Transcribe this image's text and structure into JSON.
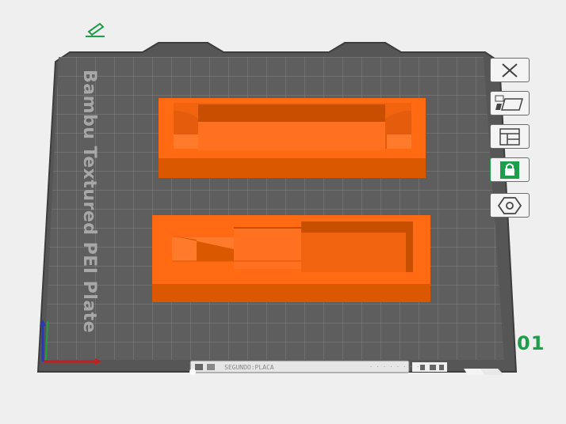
{
  "plate": {
    "label": "Bambu Textured PEI Plate",
    "number": "01",
    "bottom_bar_text": "SEGUNDO:PLACA",
    "bottom_bar_right": "· · · · · · · ·"
  },
  "toolbar": {
    "edit_icon": "pencil-icon",
    "buttons": [
      {
        "name": "remove-plate-button",
        "icon": "close-icon"
      },
      {
        "name": "auto-arrange-button",
        "icon": "auto-arrange-icon"
      },
      {
        "name": "plate-settings-button",
        "icon": "layout-icon"
      },
      {
        "name": "lock-plate-button",
        "icon": "lock-icon",
        "active": true
      },
      {
        "name": "plate-type-button",
        "icon": "hexagon-icon"
      }
    ]
  },
  "colors": {
    "background": "#efefef",
    "plate": "#5b5b5b",
    "grid": "#8a8a8a",
    "model": "#ff6a13",
    "accent": "#1c9e4a"
  }
}
